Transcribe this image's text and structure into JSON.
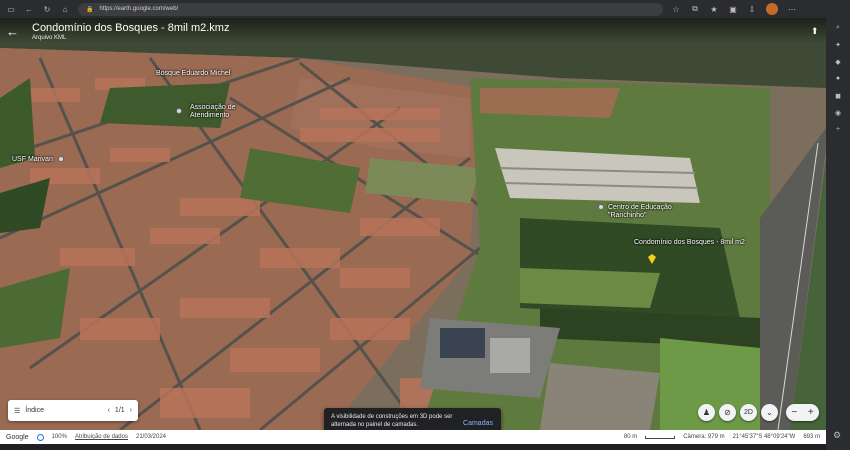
{
  "browser": {
    "url": "https://earth.google.com/web/"
  },
  "header": {
    "title": "Condomínio dos Bosques - 8mil m2.kmz",
    "subtitle": "Arquivo KML"
  },
  "map_labels": {
    "bosque": "Bosque Eduardo Michel",
    "associacao": "Associação de\nAtendimento",
    "usf": "USF Marivan",
    "centro": "Centro de Educação\n\"Ranchinho\"",
    "condominio": "Condomínio dos Bosques - 8mil m2"
  },
  "index_panel": {
    "label": "Índice",
    "page": "1/1"
  },
  "toast": {
    "text": "A visibilidade de construções em 3D pode ser alternada no painel de camadas.",
    "action": "Camadas"
  },
  "controls": {
    "view_mode": "2D"
  },
  "status_bar": {
    "google": "Google",
    "percent": "100%",
    "attribution": "Atribuição de dados",
    "date": "21/03/2024",
    "scale": "80 m",
    "camera": "Câmera: 979 m",
    "coords": "21°45'37\"S 48°09'24\"W",
    "elevation": "693 m"
  },
  "colors": {
    "accent": "#8ab4f8",
    "pin_yellow": "#f5d21a"
  }
}
